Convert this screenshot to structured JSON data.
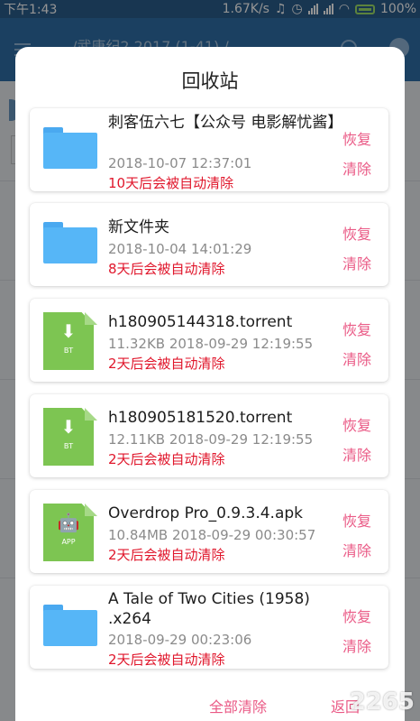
{
  "status_bar": {
    "time": "下午1:43",
    "speed": "1.67K/s",
    "battery": "100%"
  },
  "background_app": {
    "title": "/武唐纪2 2017 (1-41) /"
  },
  "dialog": {
    "title": "回收站",
    "restore_label": "恢复",
    "delete_label": "清除",
    "items": [
      {
        "icon": "folder-icon",
        "name": "刺客伍六七【公众号 电影解忧酱】",
        "meta": "2018-10-07 12:37:01",
        "warn": "10天后会被自动清除"
      },
      {
        "icon": "folder-icon",
        "name": "新文件夹",
        "meta": "2018-10-04 14:01:29",
        "warn": "8天后会被自动清除"
      },
      {
        "icon": "bt-file-icon",
        "icon_label": "BT",
        "name": "h180905144318.torrent",
        "meta": "11.32KB 2018-09-29 12:19:55",
        "warn": "2天后会被自动清除"
      },
      {
        "icon": "bt-file-icon",
        "icon_label": "BT",
        "name": "h180905181520.torrent",
        "meta": "12.11KB 2018-09-29 12:19:55",
        "warn": "2天后会被自动清除"
      },
      {
        "icon": "apk-file-icon",
        "icon_label": "APP",
        "name": "Overdrop Pro_0.9.3.4.apk",
        "meta": "10.84MB 2018-09-29 00:30:57",
        "warn": "2天后会被自动清除"
      },
      {
        "icon": "folder-icon",
        "name": "A Tale of Two Cities (1958)  .x264",
        "meta": "2018-09-29 00:23:06",
        "warn": "2天后会被自动清除"
      }
    ],
    "clear_all_label": "全部清除",
    "back_label": "返回"
  },
  "watermark": "2265",
  "colors": {
    "accent": "#ea5a86",
    "warning": "#e0162b",
    "folder": "#56b6f7",
    "file": "#7dc552"
  }
}
